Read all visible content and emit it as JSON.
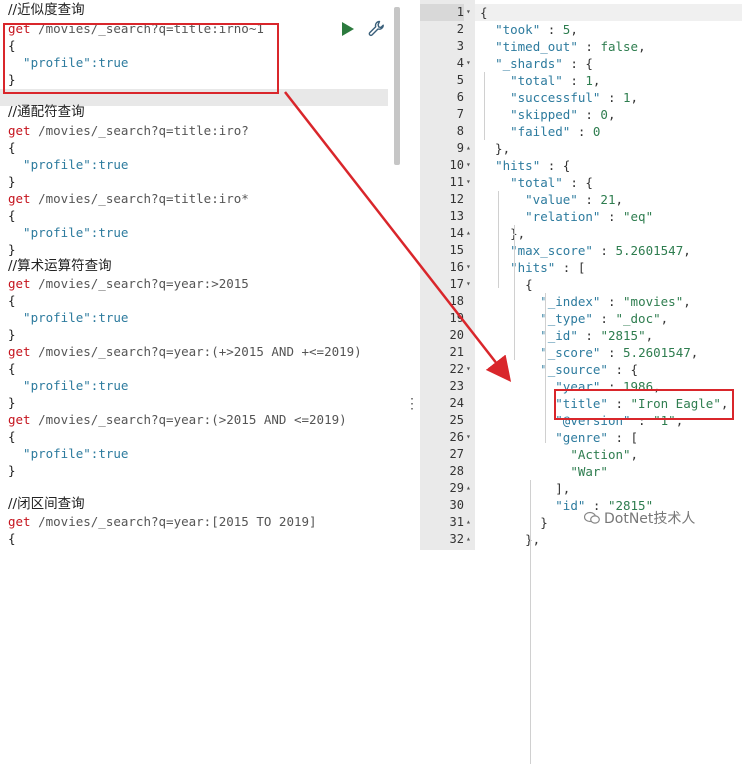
{
  "left_panel": {
    "lines": [
      {
        "kind": "comment",
        "text": "//近似度查询"
      },
      {
        "kind": "method",
        "method": "get",
        "url": " /movies/_search?q=title:irno~1"
      },
      {
        "kind": "brace",
        "text": "{"
      },
      {
        "kind": "prop",
        "key": "  \"profile\"",
        "value": ":true"
      },
      {
        "kind": "brace",
        "text": "}"
      },
      {
        "kind": "blank",
        "text": ""
      },
      {
        "kind": "comment",
        "text": "//通配符查询"
      },
      {
        "kind": "method",
        "method": "get",
        "url": " /movies/_search?q=title:iro?"
      },
      {
        "kind": "brace",
        "text": "{"
      },
      {
        "kind": "prop",
        "key": "  \"profile\"",
        "value": ":true"
      },
      {
        "kind": "brace",
        "text": "}"
      },
      {
        "kind": "method",
        "method": "get",
        "url": " /movies/_search?q=title:iro*"
      },
      {
        "kind": "brace",
        "text": "{"
      },
      {
        "kind": "prop",
        "key": "  \"profile\"",
        "value": ":true"
      },
      {
        "kind": "brace",
        "text": "}"
      },
      {
        "kind": "comment",
        "text": "//算术运算符查询"
      },
      {
        "kind": "method",
        "method": "get",
        "url": " /movies/_search?q=year:>2015"
      },
      {
        "kind": "brace",
        "text": "{"
      },
      {
        "kind": "prop",
        "key": "  \"profile\"",
        "value": ":true"
      },
      {
        "kind": "brace",
        "text": "}"
      },
      {
        "kind": "method",
        "method": "get",
        "url": " /movies/_search?q=year:(+>2015 AND +<=2019)"
      },
      {
        "kind": "brace",
        "text": "{"
      },
      {
        "kind": "prop",
        "key": "  \"profile\"",
        "value": ":true"
      },
      {
        "kind": "brace",
        "text": "}"
      },
      {
        "kind": "method",
        "method": "get",
        "url": " /movies/_search?q=year:(>2015 AND <=2019)"
      },
      {
        "kind": "brace",
        "text": "{"
      },
      {
        "kind": "prop",
        "key": "  \"profile\"",
        "value": ":true"
      },
      {
        "kind": "brace",
        "text": "}"
      },
      {
        "kind": "blank",
        "text": ""
      },
      {
        "kind": "comment",
        "text": "//闭区间查询"
      },
      {
        "kind": "method",
        "method": "get",
        "url": " /movies/_search?q=year:[2015 TO 2019]"
      },
      {
        "kind": "brace",
        "text": "{"
      }
    ]
  },
  "right_panel": {
    "lines": [
      {
        "n": "1",
        "fold": "▾",
        "parts": [
          [
            "p",
            "{"
          ]
        ]
      },
      {
        "n": "2",
        "fold": "",
        "parts": [
          [
            "p",
            "  "
          ],
          [
            "k",
            "\"took\""
          ],
          [
            "p",
            " : "
          ],
          [
            "n",
            "5"
          ],
          [
            "p",
            ","
          ]
        ]
      },
      {
        "n": "3",
        "fold": "",
        "parts": [
          [
            "p",
            "  "
          ],
          [
            "k",
            "\"timed_out\""
          ],
          [
            "p",
            " : "
          ],
          [
            "b",
            "false"
          ],
          [
            "p",
            ","
          ]
        ]
      },
      {
        "n": "4",
        "fold": "▾",
        "parts": [
          [
            "p",
            "  "
          ],
          [
            "k",
            "\"_shards\""
          ],
          [
            "p",
            " : {"
          ]
        ]
      },
      {
        "n": "5",
        "fold": "",
        "parts": [
          [
            "p",
            "    "
          ],
          [
            "k",
            "\"total\""
          ],
          [
            "p",
            " : "
          ],
          [
            "n",
            "1"
          ],
          [
            "p",
            ","
          ]
        ]
      },
      {
        "n": "6",
        "fold": "",
        "parts": [
          [
            "p",
            "    "
          ],
          [
            "k",
            "\"successful\""
          ],
          [
            "p",
            " : "
          ],
          [
            "n",
            "1"
          ],
          [
            "p",
            ","
          ]
        ]
      },
      {
        "n": "7",
        "fold": "",
        "parts": [
          [
            "p",
            "    "
          ],
          [
            "k",
            "\"skipped\""
          ],
          [
            "p",
            " : "
          ],
          [
            "n",
            "0"
          ],
          [
            "p",
            ","
          ]
        ]
      },
      {
        "n": "8",
        "fold": "",
        "parts": [
          [
            "p",
            "    "
          ],
          [
            "k",
            "\"failed\""
          ],
          [
            "p",
            " : "
          ],
          [
            "n",
            "0"
          ]
        ]
      },
      {
        "n": "9",
        "fold": "▴",
        "parts": [
          [
            "p",
            "  },"
          ]
        ]
      },
      {
        "n": "10",
        "fold": "▾",
        "parts": [
          [
            "p",
            "  "
          ],
          [
            "k",
            "\"hits\""
          ],
          [
            "p",
            " : {"
          ]
        ]
      },
      {
        "n": "11",
        "fold": "▾",
        "parts": [
          [
            "p",
            "    "
          ],
          [
            "k",
            "\"total\""
          ],
          [
            "p",
            " : {"
          ]
        ]
      },
      {
        "n": "12",
        "fold": "",
        "parts": [
          [
            "p",
            "      "
          ],
          [
            "k",
            "\"value\""
          ],
          [
            "p",
            " : "
          ],
          [
            "n",
            "21"
          ],
          [
            "p",
            ","
          ]
        ]
      },
      {
        "n": "13",
        "fold": "",
        "parts": [
          [
            "p",
            "      "
          ],
          [
            "k",
            "\"relation\""
          ],
          [
            "p",
            " : "
          ],
          [
            "s",
            "\"eq\""
          ]
        ]
      },
      {
        "n": "14",
        "fold": "▴",
        "parts": [
          [
            "p",
            "    },"
          ]
        ]
      },
      {
        "n": "15",
        "fold": "",
        "parts": [
          [
            "p",
            "    "
          ],
          [
            "k",
            "\"max_score\""
          ],
          [
            "p",
            " : "
          ],
          [
            "n",
            "5.2601547"
          ],
          [
            "p",
            ","
          ]
        ]
      },
      {
        "n": "16",
        "fold": "▾",
        "parts": [
          [
            "p",
            "    "
          ],
          [
            "k",
            "\"hits\""
          ],
          [
            "p",
            " : ["
          ]
        ]
      },
      {
        "n": "17",
        "fold": "▾",
        "parts": [
          [
            "p",
            "      {"
          ]
        ]
      },
      {
        "n": "18",
        "fold": "",
        "parts": [
          [
            "p",
            "        "
          ],
          [
            "k",
            "\"_index\""
          ],
          [
            "p",
            " : "
          ],
          [
            "s",
            "\"movies\""
          ],
          [
            "p",
            ","
          ]
        ]
      },
      {
        "n": "19",
        "fold": "",
        "parts": [
          [
            "p",
            "        "
          ],
          [
            "k",
            "\"_type\""
          ],
          [
            "p",
            " : "
          ],
          [
            "s",
            "\"_doc\""
          ],
          [
            "p",
            ","
          ]
        ]
      },
      {
        "n": "20",
        "fold": "",
        "parts": [
          [
            "p",
            "        "
          ],
          [
            "k",
            "\"_id\""
          ],
          [
            "p",
            " : "
          ],
          [
            "s",
            "\"2815\""
          ],
          [
            "p",
            ","
          ]
        ]
      },
      {
        "n": "21",
        "fold": "",
        "parts": [
          [
            "p",
            "        "
          ],
          [
            "k",
            "\"_score\""
          ],
          [
            "p",
            " : "
          ],
          [
            "n",
            "5.2601547"
          ],
          [
            "p",
            ","
          ]
        ]
      },
      {
        "n": "22",
        "fold": "▾",
        "parts": [
          [
            "p",
            "        "
          ],
          [
            "k",
            "\"_source\""
          ],
          [
            "p",
            " : {"
          ]
        ]
      },
      {
        "n": "23",
        "fold": "",
        "parts": [
          [
            "p",
            "          "
          ],
          [
            "k",
            "\"year\""
          ],
          [
            "p",
            " : "
          ],
          [
            "n",
            "1986"
          ],
          [
            "p",
            ","
          ]
        ]
      },
      {
        "n": "24",
        "fold": "",
        "parts": [
          [
            "p",
            "          "
          ],
          [
            "k",
            "\"title\""
          ],
          [
            "p",
            " : "
          ],
          [
            "s",
            "\"Iron Eagle\""
          ],
          [
            "p",
            ","
          ]
        ]
      },
      {
        "n": "25",
        "fold": "",
        "parts": [
          [
            "p",
            "          "
          ],
          [
            "k",
            "\"@version\""
          ],
          [
            "p",
            " : "
          ],
          [
            "s",
            "\"1\""
          ],
          [
            "p",
            ","
          ]
        ]
      },
      {
        "n": "26",
        "fold": "▾",
        "parts": [
          [
            "p",
            "          "
          ],
          [
            "k",
            "\"genre\""
          ],
          [
            "p",
            " : ["
          ]
        ]
      },
      {
        "n": "27",
        "fold": "",
        "parts": [
          [
            "p",
            "            "
          ],
          [
            "s",
            "\"Action\""
          ],
          [
            "p",
            ","
          ]
        ]
      },
      {
        "n": "28",
        "fold": "",
        "parts": [
          [
            "p",
            "            "
          ],
          [
            "s",
            "\"War\""
          ]
        ]
      },
      {
        "n": "29",
        "fold": "▴",
        "parts": [
          [
            "p",
            "          ],"
          ]
        ]
      },
      {
        "n": "30",
        "fold": "",
        "parts": [
          [
            "p",
            "          "
          ],
          [
            "k",
            "\"id\""
          ],
          [
            "p",
            " : "
          ],
          [
            "s",
            "\"2815\""
          ]
        ]
      },
      {
        "n": "31",
        "fold": "▴",
        "parts": [
          [
            "p",
            "        }"
          ]
        ]
      },
      {
        "n": "32",
        "fold": "▴",
        "parts": [
          [
            "p",
            "      },"
          ]
        ]
      }
    ]
  },
  "watermark": {
    "text": "DotNet技术人"
  },
  "colors": {
    "highlight_box": "#d9262b",
    "method": "#c5131d",
    "key": "#2d7b9e",
    "string": "#2e7d4f"
  },
  "icons": {
    "run": "play-icon",
    "settings": "wrench-icon",
    "splitter": "vertical-ellipsis-icon"
  }
}
